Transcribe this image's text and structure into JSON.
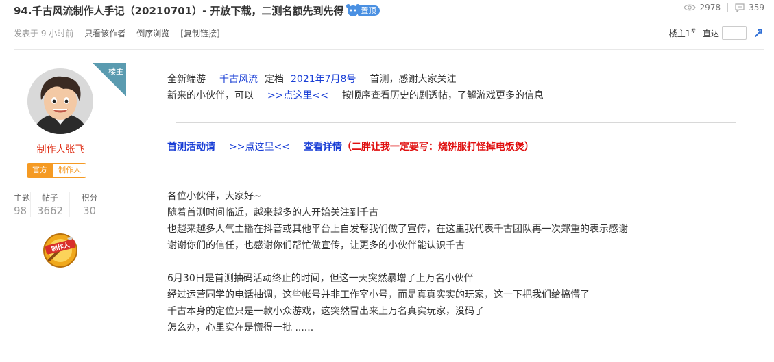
{
  "thread": {
    "title": "94.千古风流制作人手记（20210701）- 开放下载，二测名额先到先得",
    "pin_label": "置顶",
    "views": "2978",
    "replies": "359"
  },
  "meta": {
    "posted": "发表于 9 小时前",
    "only_author": "只看该作者",
    "reverse": "倒序浏览",
    "copy_link": "[复制链接]"
  },
  "floor_nav": {
    "floor_label": "楼主",
    "floor_number": "1",
    "floor_suffix": "#",
    "goto_label": "直达",
    "goto_value": ""
  },
  "author": {
    "ribbon": "楼主",
    "name": "制作人张飞",
    "tag_official": "官方",
    "tag_role": "制作人",
    "stats": [
      {
        "label": "主题",
        "value": "98"
      },
      {
        "label": "帖子",
        "value": "3662"
      },
      {
        "label": "积分",
        "value": "30"
      }
    ],
    "medal_text": "制作人"
  },
  "post": {
    "l1_a": "全新端游",
    "l1_b": "千古风流",
    "l1_c": "定档",
    "l1_d": "2021年7月8号",
    "l1_e": "首测，感谢大家关注",
    "l2_a": "新来的小伙伴，可以",
    "l2_link": ">>点这里<<",
    "l2_b": "按顺序查看历史的剧透帖，了解游戏更多的信息",
    "l3_a": "首测活动请",
    "l3_link": ">>点这里<<",
    "l3_b": "查看详情",
    "l3_c": "（二胖让我一定要写：烧饼服打怪掉电饭煲）",
    "p1": [
      "各位小伙伴，大家好~",
      "随着首测时间临近，越来越多的人开始关注到千古",
      "也越来越多人气主播在抖音或其他平台上自发帮我们做了宣传，在这里我代表千古团队再一次郑重的表示感谢",
      "谢谢你们的信任，也感谢你们帮忙做宣传，让更多的小伙伴能认识千古"
    ],
    "p2": [
      "6月30日是首测抽码活动终止的时间，但这一天突然暴增了上万名小伙伴",
      "经过运营同学的电话抽调，这些帐号并非工作室小号，而是真真实实的玩家，这一下把我们给搞懵了",
      "千古本身的定位只是一款小众游戏，这突然冒出来上万名真实玩家，没码了",
      "怎么办，心里实在是慌得一批 ......"
    ]
  }
}
